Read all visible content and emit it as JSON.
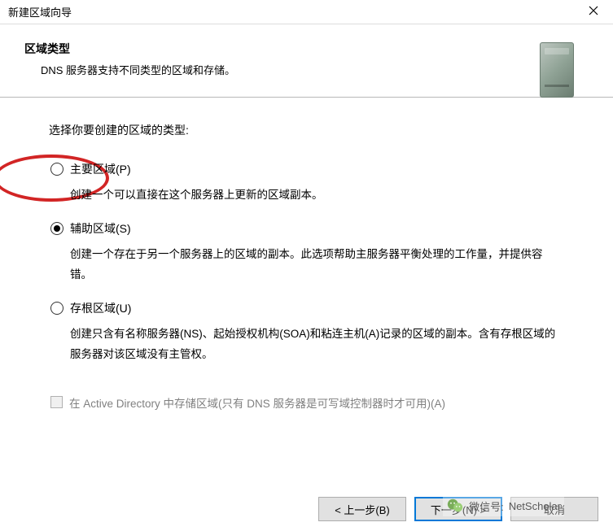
{
  "titlebar": {
    "title": "新建区域向导"
  },
  "header": {
    "title": "区域类型",
    "subtitle": "DNS 服务器支持不同类型的区域和存储。"
  },
  "content": {
    "prompt": "选择你要创建的区域的类型:",
    "options": [
      {
        "label": "主要区域(P)",
        "desc": "创建一个可以直接在这个服务器上更新的区域副本。",
        "checked": false
      },
      {
        "label": "辅助区域(S)",
        "desc": "创建一个存在于另一个服务器上的区域的副本。此选项帮助主服务器平衡处理的工作量，并提供容错。",
        "checked": true
      },
      {
        "label": "存根区域(U)",
        "desc": "创建只含有名称服务器(NS)、起始授权机构(SOA)和粘连主机(A)记录的区域的副本。含有存根区域的服务器对该区域没有主管权。",
        "checked": false
      }
    ],
    "adCheckbox": {
      "label": "在 Active Directory 中存储区域(只有 DNS 服务器是可写域控制器时才可用)(A)",
      "enabled": false,
      "checked": false
    }
  },
  "buttons": {
    "back": "< 上一步(B)",
    "next": "下一步(N) >",
    "cancel": "取消"
  },
  "watermark": {
    "label": "微信号:",
    "value": "NetScholar"
  }
}
